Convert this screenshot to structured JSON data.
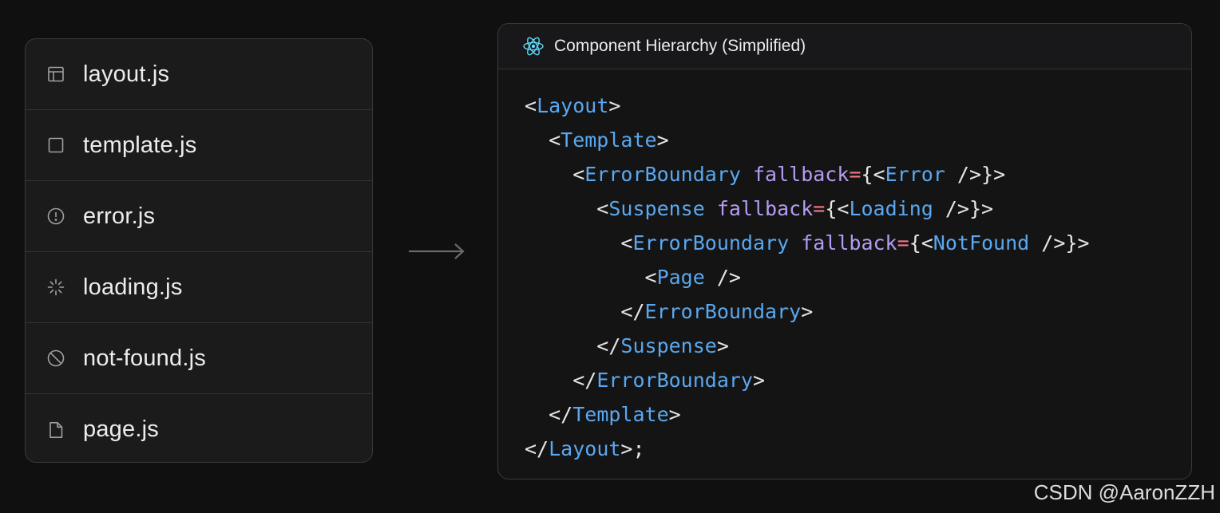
{
  "files": [
    {
      "icon": "layout-icon",
      "label": "layout.js"
    },
    {
      "icon": "template-icon",
      "label": "template.js"
    },
    {
      "icon": "error-icon",
      "label": "error.js"
    },
    {
      "icon": "loading-icon",
      "label": "loading.js"
    },
    {
      "icon": "not-found-icon",
      "label": "not-found.js"
    },
    {
      "icon": "page-icon",
      "label": "page.js"
    }
  ],
  "panel": {
    "title": "Component Hierarchy (Simplified)",
    "icon": "react-icon",
    "code_lines": [
      [
        [
          "punct",
          "<"
        ],
        [
          "tag",
          "Layout"
        ],
        [
          "punct",
          ">"
        ]
      ],
      [
        [
          "punct",
          "  <"
        ],
        [
          "tag",
          "Template"
        ],
        [
          "punct",
          ">"
        ]
      ],
      [
        [
          "punct",
          "    <"
        ],
        [
          "tag",
          "ErrorBoundary"
        ],
        [
          "punct",
          " "
        ],
        [
          "attr",
          "fallback"
        ],
        [
          "eq",
          "="
        ],
        [
          "punct",
          "{<"
        ],
        [
          "tag",
          "Error"
        ],
        [
          "punct",
          " />}>"
        ]
      ],
      [
        [
          "punct",
          "      <"
        ],
        [
          "tag",
          "Suspense"
        ],
        [
          "punct",
          " "
        ],
        [
          "attr",
          "fallback"
        ],
        [
          "eq",
          "="
        ],
        [
          "punct",
          "{<"
        ],
        [
          "tag",
          "Loading"
        ],
        [
          "punct",
          " />}>"
        ]
      ],
      [
        [
          "punct",
          "        <"
        ],
        [
          "tag",
          "ErrorBoundary"
        ],
        [
          "punct",
          " "
        ],
        [
          "attr",
          "fallback"
        ],
        [
          "eq",
          "="
        ],
        [
          "punct",
          "{<"
        ],
        [
          "tag",
          "NotFound"
        ],
        [
          "punct",
          " />}>"
        ]
      ],
      [
        [
          "punct",
          "          <"
        ],
        [
          "tag",
          "Page"
        ],
        [
          "punct",
          " />"
        ]
      ],
      [
        [
          "punct",
          "        </"
        ],
        [
          "tag",
          "ErrorBoundary"
        ],
        [
          "punct",
          ">"
        ]
      ],
      [
        [
          "punct",
          "      </"
        ],
        [
          "tag",
          "Suspense"
        ],
        [
          "punct",
          ">"
        ]
      ],
      [
        [
          "punct",
          "    </"
        ],
        [
          "tag",
          "ErrorBoundary"
        ],
        [
          "punct",
          ">"
        ]
      ],
      [
        [
          "punct",
          "  </"
        ],
        [
          "tag",
          "Template"
        ],
        [
          "punct",
          ">"
        ]
      ],
      [
        [
          "punct",
          "</"
        ],
        [
          "tag",
          "Layout"
        ],
        [
          "punct",
          ">;"
        ]
      ]
    ]
  },
  "colors": {
    "tag": "#5aa8f0",
    "attr": "#b59cf2",
    "equals": "#f07a8a",
    "react": "#61dafb"
  },
  "watermark": "CSDN @AaronZZH"
}
